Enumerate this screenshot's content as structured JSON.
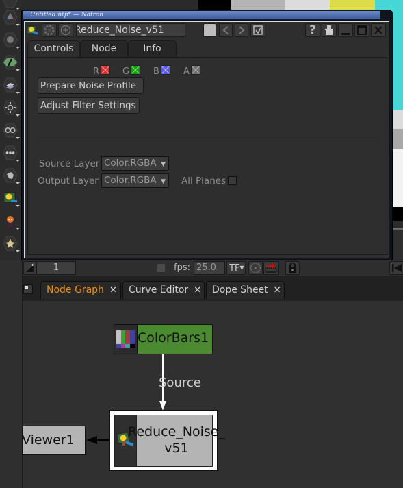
{
  "window": {
    "title": "Untitled.ntp* — Natron"
  },
  "background": {
    "colorbars": [
      "#000000",
      "#b4b4b4",
      "#dcdcdc",
      "#dcdc48",
      "#46d6d6"
    ],
    "right_strip": [
      "#46d6d6",
      "#dcdcdc",
      "#a8a8a8",
      "#f2f2f2",
      "#000000",
      "#2a2a2a",
      "#6a6a6a",
      "#2e2e2e"
    ]
  },
  "toolbar": {
    "tools": [
      {
        "name": "image-tool-icon"
      },
      {
        "name": "color-tool-icon"
      },
      {
        "name": "channel-tool-icon"
      },
      {
        "name": "paint-tool-icon"
      },
      {
        "name": "merge-tool-icon"
      },
      {
        "name": "transform-tool-icon"
      },
      {
        "name": "views-tool-icon"
      },
      {
        "name": "other-tool-icon"
      },
      {
        "name": "gmic-tool-icon"
      },
      {
        "name": "plugin-tool-icon"
      },
      {
        "name": "natron-mascot-icon"
      },
      {
        "name": "extra-tool-icon"
      }
    ]
  },
  "properties_panel": {
    "node_name": "Reduce_Noise_v51",
    "tabs": [
      {
        "label": "Controls",
        "active": true
      },
      {
        "label": "Node",
        "active": false
      },
      {
        "label": "Info",
        "active": false
      }
    ],
    "channels": [
      {
        "label": "R",
        "color": "#d93030",
        "checked": true
      },
      {
        "label": "G",
        "color": "#10a010",
        "checked": true
      },
      {
        "label": "B",
        "color": "#5a5ae6",
        "checked": true
      },
      {
        "label": "A",
        "color": "#707070",
        "checked": true
      }
    ],
    "buttons": {
      "prepare": "Prepare Noise Profile",
      "adjust": "Adjust Filter Settings"
    },
    "source_layer": {
      "label": "Source Layer",
      "value": "Color.RGBA"
    },
    "output_layer": {
      "label": "Output Layer",
      "value": "Color.RGBA"
    },
    "all_planes": {
      "label": "All Planes",
      "checked": false
    }
  },
  "timeline": {
    "frame": "1",
    "fps_label": "fps:",
    "fps_value": "25.0",
    "turbo_label": "TF"
  },
  "bottom_tabs": [
    {
      "label": "Node Graph",
      "active": true
    },
    {
      "label": "Curve Editor",
      "active": false
    },
    {
      "label": "Dope Sheet",
      "active": false
    }
  ],
  "node_graph": {
    "nodes": [
      {
        "name": "ColorBars1",
        "color": "#4c8a32"
      },
      {
        "name_line1": "Reduce_Noise_",
        "name_line2": "v51",
        "color": "#b4b4b4",
        "selected": true
      },
      {
        "name": "Viewer1",
        "color": "#b4b4b4"
      }
    ],
    "edge_label": "Source"
  }
}
